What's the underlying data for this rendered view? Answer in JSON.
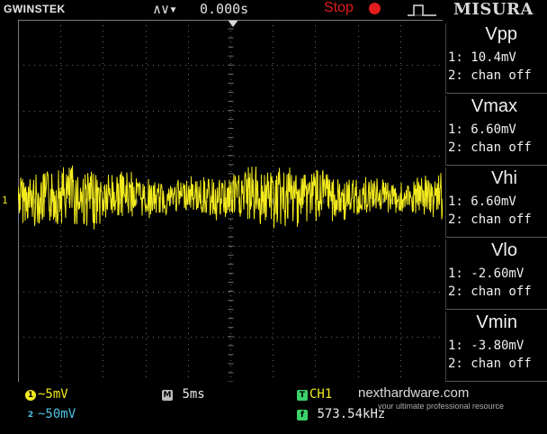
{
  "header": {
    "brand": "GWINSTEK",
    "trigger_glyph": "∧∨▾",
    "delay": "0.000s",
    "run_state": "Stop",
    "watermark": "MISURA"
  },
  "measurements": [
    {
      "title": "Vpp",
      "ch1": "1: 10.4mV",
      "ch2": "2: chan off"
    },
    {
      "title": "Vmax",
      "ch1": "1: 6.60mV",
      "ch2": "2: chan off"
    },
    {
      "title": "Vhi",
      "ch1": "1: 6.60mV",
      "ch2": "2: chan off"
    },
    {
      "title": "Vlo",
      "ch1": "1: -2.60mV",
      "ch2": "2: chan off"
    },
    {
      "title": "Vmin",
      "ch1": "1: -3.80mV",
      "ch2": "2: chan off"
    }
  ],
  "footer": {
    "ch1_badge": "1",
    "ch1_scale": "~5mV",
    "ch2_badge": "2",
    "ch2_scale": "~50mV",
    "timebase_badge": "M",
    "timebase": "5ms",
    "trigger_badge": "T",
    "trigger_source": "CH1",
    "freq_badge": "f",
    "frequency": "573.54kHz"
  },
  "branding": {
    "site": "nexthardware.com",
    "tagline": "your ultimate professional resource"
  },
  "channel_marker": "1",
  "colors": {
    "ch1": "#f2ea1e",
    "ch2": "#4fc3e8",
    "stop": "#e21c1c",
    "grid": "#8a8a8a",
    "trigger": "#3cd16a"
  }
}
